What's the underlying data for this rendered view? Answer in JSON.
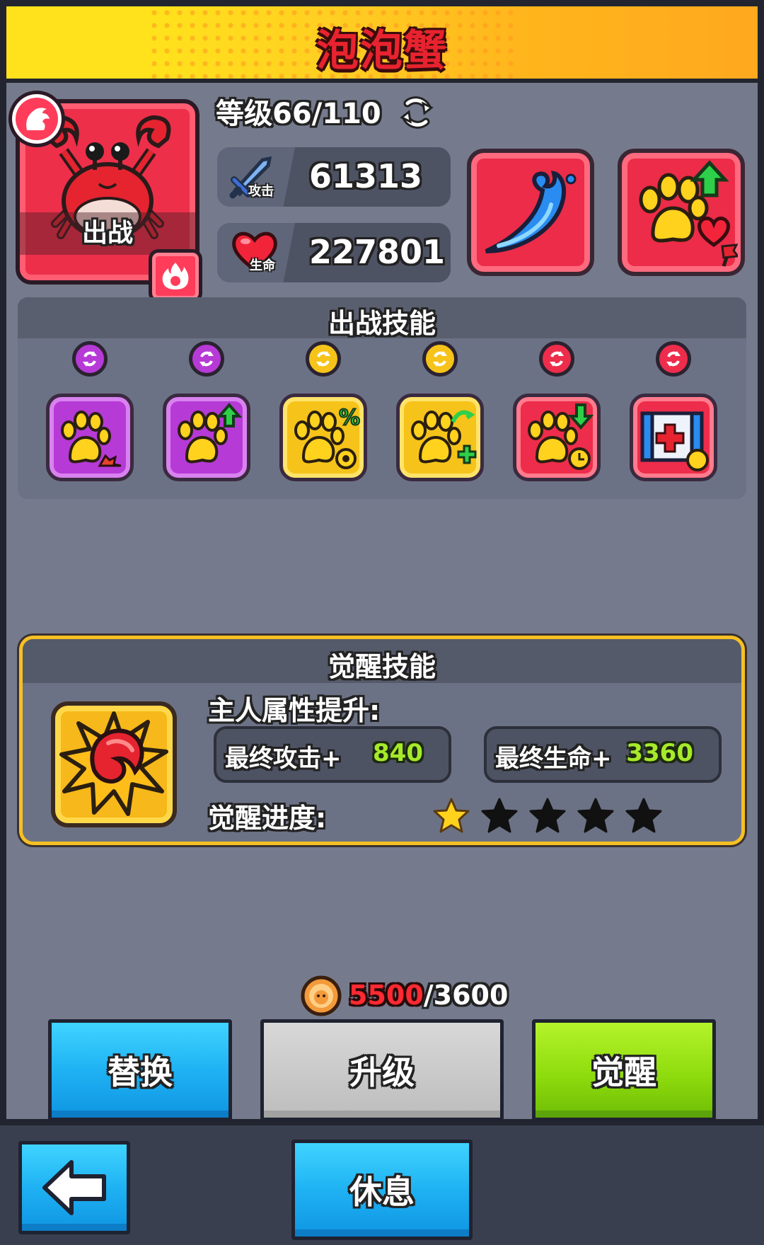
{
  "header": {
    "title": "泡泡蟹"
  },
  "pet": {
    "status_label": "出战",
    "level_text": "等级66/110",
    "attack_label": "攻击",
    "attack_value": "61313",
    "hp_label": "生命",
    "hp_value": "227801"
  },
  "battle_skills": {
    "title": "出战技能",
    "skills": [
      {
        "color": "purple",
        "icon": "paw-crab-icon"
      },
      {
        "color": "purple",
        "icon": "paw-arrow-up-icon"
      },
      {
        "color": "yellow",
        "icon": "paw-percent-gear-icon"
      },
      {
        "color": "yellow",
        "icon": "paw-heal-icon"
      },
      {
        "color": "red",
        "icon": "paw-cooldown-icon"
      },
      {
        "color": "red",
        "icon": "medkit-paw-icon"
      }
    ]
  },
  "awakening": {
    "title": "觉醒技能",
    "owner_boost_label": "主人属性提升:",
    "final_attack_label": "最终攻击+",
    "final_attack_value": "840",
    "final_hp_label": "最终生命+",
    "final_hp_value": "3360",
    "progress_label": "觉醒进度:",
    "stars_filled": 1,
    "stars_total": 5
  },
  "cost": {
    "have": "5500",
    "need": "/3600"
  },
  "buttons": {
    "replace": "替换",
    "upgrade": "升级",
    "awaken": "觉醒",
    "rest": "休息"
  },
  "colors": {
    "header_yellow": "#ffd21e",
    "card_red": "#ed2f4a",
    "skill_purple": "#b63ad6",
    "skill_yellow": "#f6c31a",
    "button_blue": "#1fb2f3",
    "button_green": "#8fdc0e",
    "awaken_border": "#f6c022"
  }
}
